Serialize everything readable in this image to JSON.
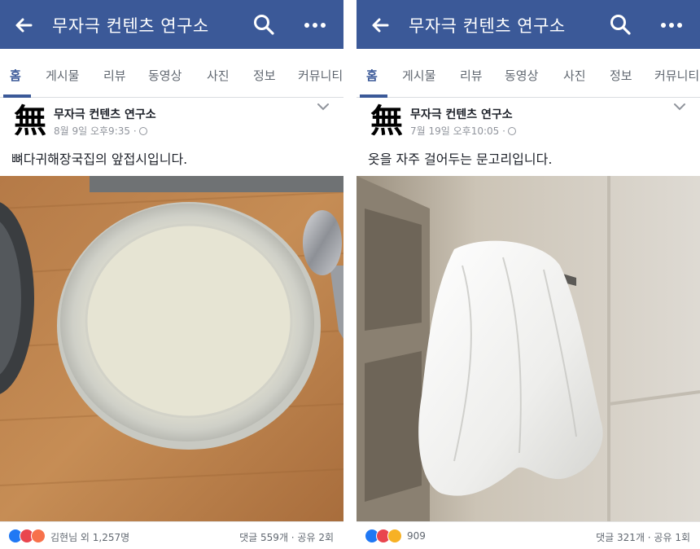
{
  "colors": {
    "brand": "#3b5998",
    "like": "#2078f4",
    "love": "#e9454e",
    "angry": "#f7714b",
    "haha": "#f7b125"
  },
  "posts": [
    {
      "header": {
        "title": "무자극 컨텐츠 연구소",
        "back_icon": "back-arrow-icon",
        "search_icon": "search-icon",
        "more_icon": "more-icon"
      },
      "tabs": [
        "홈",
        "게시물",
        "리뷰",
        "동영상",
        "사진",
        "정보",
        "커뮤니티"
      ],
      "active_tab": "홈",
      "avatar_text": "無",
      "page_name": "무자극 컨텐츠 연구소",
      "timestamp": "8월 9일 오후9:35 ·",
      "caption": "뼈다귀해장국집의 앞접시입니다.",
      "photo_alt": "bowl photo",
      "reactions": [
        "like",
        "love",
        "angry"
      ],
      "reaction_text": "김현님 외 1,257명",
      "stats": "댓글 559개 · 공유 2회"
    },
    {
      "header": {
        "title": "무자극 컨텐츠 연구소",
        "back_icon": "back-arrow-icon",
        "search_icon": "search-icon",
        "more_icon": "more-icon"
      },
      "tabs": [
        "홈",
        "게시물",
        "리뷰",
        "동영상",
        "사진",
        "정보",
        "커뮤니티"
      ],
      "active_tab": "홈",
      "avatar_text": "無",
      "page_name": "무자극 컨텐츠 연구소",
      "timestamp": "7월 19일 오후10:05 ·",
      "caption": "옷을 자주 걸어두는 문고리입니다.",
      "photo_alt": "towel on hook photo",
      "reactions": [
        "like",
        "love",
        "haha"
      ],
      "reaction_text": "909",
      "stats": "댓글 321개 · 공유 1회"
    }
  ]
}
